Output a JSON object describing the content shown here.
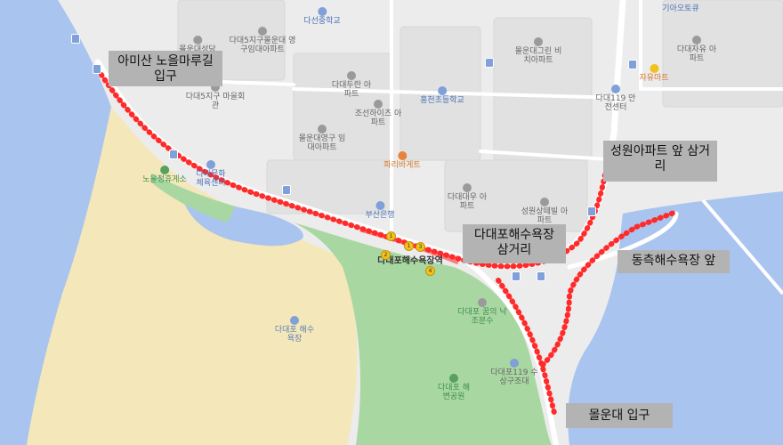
{
  "callouts": {
    "amisan": "아미산 노을마루길 입구",
    "seongwon": "성원아파트 앞 삼거리",
    "dadaepo_market": "다대포해수욕장 삼거리",
    "dongchuk": "동측해수욕장 앞",
    "molundae": "몰운대 입구"
  },
  "pois": {
    "dadae5_office": "다대5지구 마을회관",
    "dadae5_apt": "다대5지구몰운대 영구임대아파트",
    "dasun_middle": "다선중학교",
    "dadae_duran": "다대두란 아파트",
    "joseon_apt": "조선하이츠 아파트",
    "molun_rental": "몰운대영구 임대아파트",
    "hongtan_elem": "홍천초등학교",
    "molun_beach_apt": "몰운대그린 비치아파트",
    "dadae119": "다대119 안전센터",
    "kia_repair": "기아오토큐",
    "jayu_mart": "자유마트",
    "dadae_jayu_apt": "다대자유 아파트",
    "paris_bakery": "파리바게트",
    "dadae_daewoo": "다대대우 아파트",
    "seongwon_apt": "성원상떼빌 아파트",
    "busan_bank": "부산은행",
    "dadaepo_station": "다대포해수욕장역",
    "noeul_rest": "노을정휴게소",
    "dadae_culture": "다대문화 체육센터",
    "dadae_beach_park": "다대포 해변공원",
    "dadaepo_beach": "다대포 해수욕장",
    "dadae_dream": "다대포 꿈의 낙조분수",
    "dadae119_rescue": "다대포119 수상구조대",
    "molundae_top": "몰운대성당"
  },
  "colors": {
    "sea": "#a9c4ee",
    "sand": "#f4e7b9",
    "park": "#a9d7a2",
    "road": "#ffffff",
    "block": "#e2e2e2",
    "route": "#ff2a2a",
    "callout_bg": "#b3b3b3"
  },
  "icons": [
    "bus-stop-icon",
    "subway-exit-icon",
    "poi-pin-icon"
  ]
}
